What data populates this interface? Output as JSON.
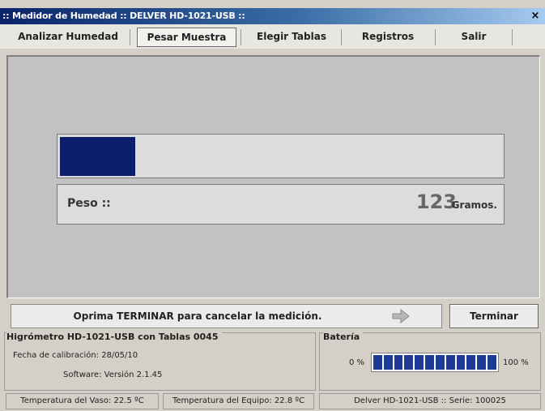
{
  "window": {
    "title": ":: Medidor de Humedad :: DELVER HD-1021-USB ::",
    "close_symbol": "×"
  },
  "menu": {
    "tabs": [
      {
        "label": "Analizar Humedad"
      },
      {
        "label": "Pesar Muestra",
        "active": true
      },
      {
        "label": "Elegir Tablas"
      },
      {
        "label": "Registros"
      },
      {
        "label": "Salir"
      }
    ]
  },
  "main": {
    "progress_fraction": 0.17,
    "progress_color": "#0c1f6b",
    "peso_label": "Peso ::",
    "peso_value": "123",
    "peso_unit": "Gramos."
  },
  "message": {
    "text": "Oprima TERMINAR para cancelar la medición.",
    "arrow_icon": "right-arrow-icon"
  },
  "terminar_button": {
    "label": "Terminar"
  },
  "device_info": {
    "title": "Higrómetro HD-1021-USB con Tablas  0045",
    "calibration": "Fecha de calibración: 28/05/10",
    "software": "Software: Versión 2.1.45"
  },
  "battery": {
    "title": "Batería",
    "min_label": "0 %",
    "max_label": "100 %",
    "segments": 12,
    "level": 1.0
  },
  "status_bar": {
    "vaso": "Temperatura del Vaso: 22.5 ºC",
    "equipo": "Temperatura del Equipo: 22.8 ºC",
    "serie": "Delver HD-1021-USB :: Serie: 100025"
  }
}
